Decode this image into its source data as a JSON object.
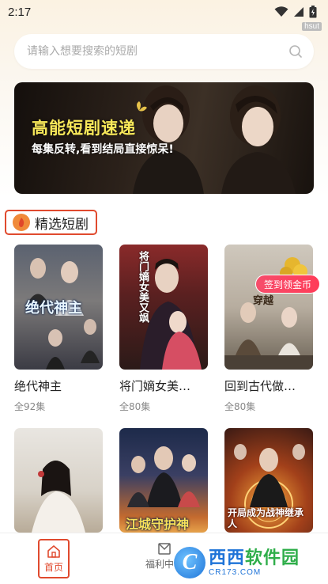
{
  "status_bar": {
    "time": "2:17",
    "tag": "hsut"
  },
  "search": {
    "placeholder": "请输入想要搜索的短剧"
  },
  "banner": {
    "title": "高能短剧速递",
    "subtitle": "每集反转,看到结局直接惊呆!"
  },
  "section": {
    "title": "精选短剧"
  },
  "dramas": [
    {
      "title": "绝代神主",
      "episodes": "全92集",
      "cover_text": "绝代神主"
    },
    {
      "title": "将门嫡女美…",
      "episodes": "全80集",
      "cover_text": "将门嫡女美又飒"
    },
    {
      "title": "回到古代做…",
      "episodes": "全80集",
      "cover_text": "穿越"
    },
    {
      "title": "",
      "episodes": "",
      "cover_text": ""
    },
    {
      "title": "",
      "episodes": "",
      "cover_text": "江城守护神"
    },
    {
      "title": "",
      "episodes": "",
      "cover_text": "开局成为战神继承人"
    }
  ],
  "signin_badge": "签到领金币",
  "bottom_nav": {
    "home_label": "首页",
    "welfare_label": "福利中心"
  },
  "watermark": {
    "brand_a": "西西",
    "brand_b": "软件园",
    "url": "CR173.COM"
  },
  "colors": {
    "accent": "#e04a2e",
    "banner_title": "#f9e95a",
    "badge": "#ff3c58"
  }
}
